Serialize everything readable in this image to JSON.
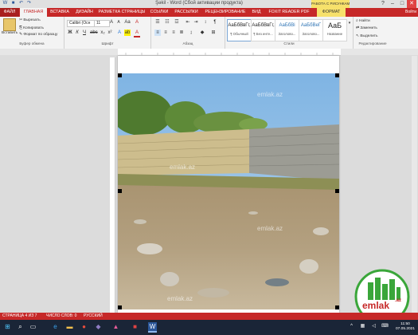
{
  "window": {
    "title": "Şəkil - Word (Сбой активации продукта)",
    "picture_tools_tab": "РАБОТА С РИСУНКАМИ",
    "account": "Войти"
  },
  "tabs": [
    {
      "label": "ФАЙЛ"
    },
    {
      "label": "ГЛАВНАЯ"
    },
    {
      "label": "ВСТАВКА"
    },
    {
      "label": "ДИЗАЙН"
    },
    {
      "label": "РАЗМЕТКА СТРАНИЦЫ"
    },
    {
      "label": "ССЫЛКИ"
    },
    {
      "label": "РАССЫЛКИ"
    },
    {
      "label": "РЕЦЕНЗИРОВАНИЕ"
    },
    {
      "label": "ВИД"
    },
    {
      "label": "FOXIT READER PDF"
    },
    {
      "label": "ФОРМАТ"
    }
  ],
  "clipboard": {
    "paste": "Вставить",
    "cut": "Вырезать",
    "copy": "Копировать",
    "format_painter": "Формат по образцу",
    "group": "Буфер обмена"
  },
  "font": {
    "family": "Calibri (Осн",
    "size": "11",
    "group": "Шрифт"
  },
  "paragraph": {
    "group": "Абзац"
  },
  "styles": {
    "items": [
      {
        "sample": "АаБбВвГг,",
        "name": "¶ Обычный"
      },
      {
        "sample": "АаБбВвГг,",
        "name": "¶ Без инте..."
      },
      {
        "sample": "АаБбВі",
        "name": "Заголово..."
      },
      {
        "sample": "АаБбВеГ",
        "name": "Заголово..."
      },
      {
        "sample": "АаБ",
        "name": "Название"
      }
    ],
    "group": "Стили"
  },
  "editing": {
    "find": "Найти",
    "replace": "Заменить",
    "select": "Выделить",
    "group": "Редактирование"
  },
  "watermark": "emlak.az",
  "logo": {
    "text": "emlak",
    "suffix": ".az"
  },
  "status": {
    "page": "СТРАНИЦА 4 ИЗ 7",
    "words": "ЧИСЛО СЛОВ: 0",
    "language": "РУССКИЙ"
  },
  "clock": {
    "time": "11:50",
    "date": "07.05.2021"
  },
  "colors": {
    "accent": "#c62828",
    "picture_tools": "#f7e16b",
    "taskbar": "#1a2537"
  },
  "icons": [
    "save-icon",
    "undo-icon",
    "redo-icon",
    "search-icon",
    "windows-icon",
    "edge-icon",
    "explorer-icon",
    "chrome-icon",
    "word-icon"
  ]
}
